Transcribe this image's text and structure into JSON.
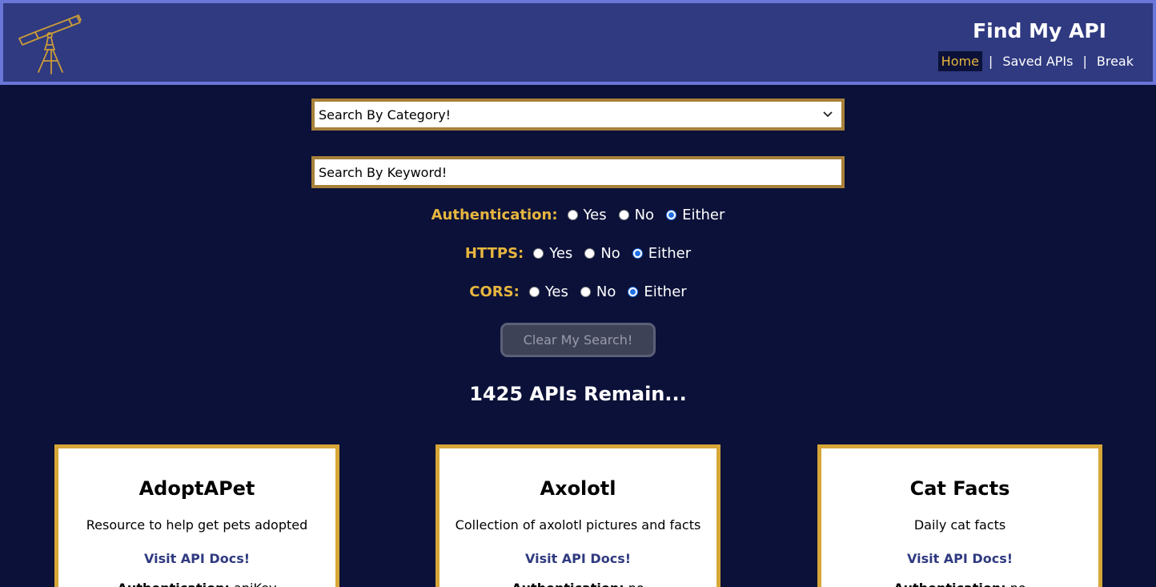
{
  "header": {
    "title": "Find My API",
    "nav": {
      "home": "Home",
      "saved": "Saved APIs",
      "break": "Break",
      "separator": "|"
    }
  },
  "search": {
    "category_selected": "Search By Category!",
    "keyword_placeholder": "Search By Keyword!"
  },
  "filters": [
    {
      "label": "Authentication:",
      "options": [
        "Yes",
        "No",
        "Either"
      ],
      "selected": "Either"
    },
    {
      "label": "HTTPS:",
      "options": [
        "Yes",
        "No",
        "Either"
      ],
      "selected": "Either"
    },
    {
      "label": "CORS:",
      "options": [
        "Yes",
        "No",
        "Either"
      ],
      "selected": "Either"
    }
  ],
  "clear_button": "Clear My Search!",
  "remaining": "1425 APIs Remain...",
  "cards": [
    {
      "title": "AdoptAPet",
      "description": "Resource to help get pets adopted",
      "link": "Visit API Docs!",
      "auth_label": "Authentication:",
      "auth_value": "apiKey"
    },
    {
      "title": "Axolotl",
      "description": "Collection of axolotl pictures and facts",
      "link": "Visit API Docs!",
      "auth_label": "Authentication:",
      "auth_value": "no"
    },
    {
      "title": "Cat Facts",
      "description": "Daily cat facts",
      "link": "Visit API Docs!",
      "auth_label": "Authentication:",
      "auth_value": "no"
    }
  ],
  "colors": {
    "header_bg": "#2f3a80",
    "page_bg": "#0b1138",
    "accent_gold": "#e7b63f",
    "card_border": "#d6a637"
  },
  "icons": {
    "logo": "telescope-icon",
    "select_chevron": "chevron-down-icon"
  }
}
